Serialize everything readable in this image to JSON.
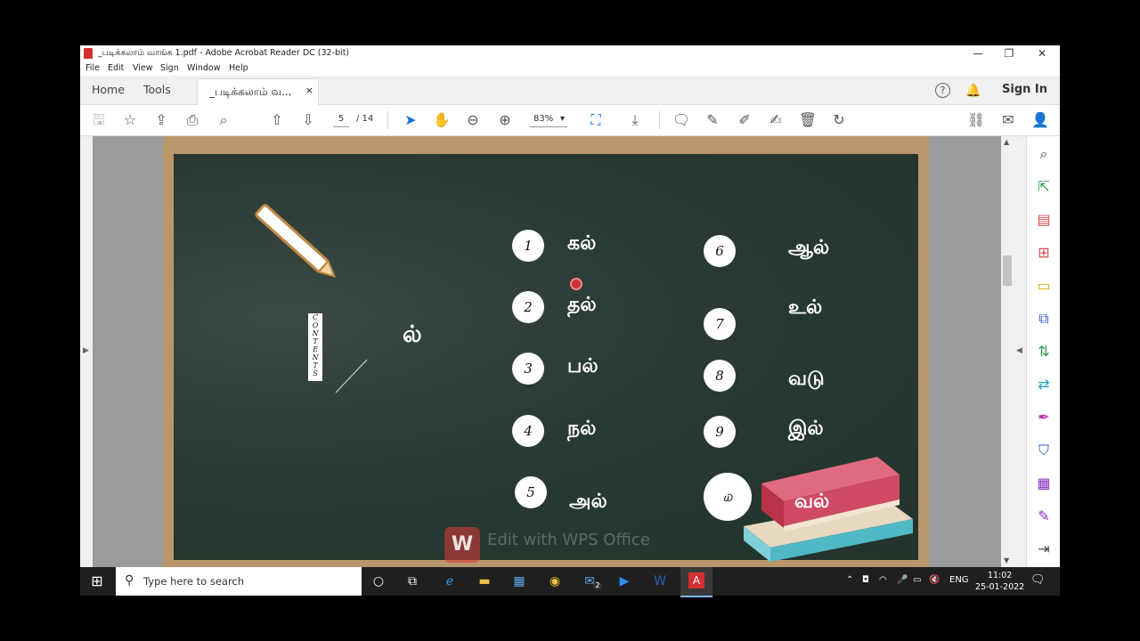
{
  "window": {
    "title": "_படிக்கலாம் வாங்க 1.pdf - Adobe Acrobat Reader DC (32-bit)",
    "controls": {
      "minimize": "—",
      "maximize": "❐",
      "close": "✕"
    }
  },
  "menu": {
    "items": [
      "File",
      "Edit",
      "View",
      "Sign",
      "Window",
      "Help"
    ]
  },
  "tabs": {
    "home": "Home",
    "tools": "Tools",
    "document": "_படிக்கலாம் வ...",
    "close": "×"
  },
  "header": {
    "help": "?",
    "sign_in": "Sign In"
  },
  "toolbar": {
    "page_current": "5",
    "page_total": "/ 14",
    "zoom": "83%",
    "zoom_arrow": "▾"
  },
  "slide": {
    "big_letter": "ல்",
    "contents_label": "CONTENTS",
    "watermark": "Edit with WPS Office",
    "watermark_logo": "W",
    "items_left": [
      {
        "number": "1",
        "word": "கல்"
      },
      {
        "number": "2",
        "word": "தல்"
      },
      {
        "number": "3",
        "word": "பல்"
      },
      {
        "number": "4",
        "word": "நல்"
      },
      {
        "number": "5",
        "word": "அல்"
      }
    ],
    "items_right": [
      {
        "number": "6",
        "word": "ஆல்"
      },
      {
        "number": "7",
        "word": "உல்"
      },
      {
        "number": "8",
        "word": "வடு"
      },
      {
        "number": "9",
        "word": "இல்"
      },
      {
        "number": "௰",
        "word": "வல்"
      }
    ]
  },
  "taskbar": {
    "search_placeholder": "Type here to search",
    "mail_badge": "2",
    "language": "ENG",
    "time": "11:02",
    "date": "25-01-2022"
  }
}
